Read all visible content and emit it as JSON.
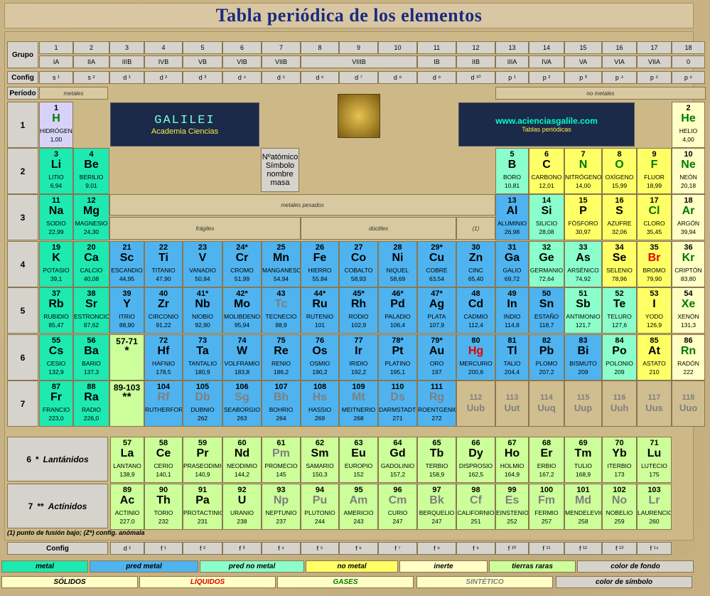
{
  "title": "Tabla periódica de los elementos",
  "labels": {
    "grupo": "Grupo",
    "config": "Config",
    "periodo": "Período",
    "metales": "metales",
    "no_metales": "no metales",
    "metales_pesados": "metales pesados",
    "fragiles": "frágiles",
    "ductiles": "dúctiles",
    "note1": "(1)",
    "lantanidos": "Lantánidos",
    "actinidos": "Actínidos",
    "lan_num": "6",
    "act_num": "7",
    "star1": "*",
    "star2": "**",
    "footnote": "(1) punto de fusión bajo; (Z*) config. anómala",
    "config_bottom": "Config"
  },
  "groups": [
    "1",
    "2",
    "3",
    "4",
    "5",
    "6",
    "7",
    "8",
    "9",
    "10",
    "11",
    "12",
    "13",
    "14",
    "15",
    "16",
    "17",
    "18"
  ],
  "subgroups": [
    "IA",
    "IIA",
    "IIIB",
    "IVB",
    "VB",
    "VIB",
    "VIIB",
    "VIIIB",
    "IB",
    "IIB",
    "IIIA",
    "IVA",
    "VA",
    "VIA",
    "VIIA",
    "0"
  ],
  "configs": [
    "s ¹",
    "s ²",
    "d ¹",
    "d ²",
    "d ³",
    "d ⁴",
    "d ⁵",
    "d ⁶",
    "d ⁷",
    "d ⁸",
    "d ⁹",
    "d ¹⁰",
    "p ¹",
    "p ²",
    "p ³",
    "p ⁴",
    "p ⁵",
    "p ⁶"
  ],
  "fconfigs": [
    "d ¹",
    "f ¹",
    "f ²",
    "f ³",
    "f ⁴",
    "f ⁵",
    "f ⁶",
    "f ⁷",
    "f ⁸",
    "f ⁹",
    "f ¹⁰",
    "f ¹¹",
    "f ¹²",
    "f ¹³",
    "f ¹⁴"
  ],
  "periods": [
    "1",
    "2",
    "3",
    "4",
    "5",
    "6",
    "7"
  ],
  "key": {
    "l1": "Nºatómico",
    "l2": "Símbolo",
    "l3": "nombre",
    "l4": "masa"
  },
  "galilei": {
    "title": "GALILEI",
    "sub": "Academia Ciencias"
  },
  "web": {
    "url": "www.acienciasgalile.com",
    "sub": "Tablas periódicas"
  },
  "placeholders": {
    "lan": "57-71",
    "lan_star": "*",
    "act": "89-103",
    "act_star": "**"
  },
  "elements": [
    [
      "1",
      "H",
      "HIDRÓGENO",
      "1,00"
    ],
    [
      "2",
      "He",
      "HELIO",
      "4,00"
    ],
    [
      "3",
      "Li",
      "LITIO",
      "6,94"
    ],
    [
      "4",
      "Be",
      "BERILIO",
      "9,01"
    ],
    [
      "5",
      "B",
      "BORO",
      "10,81"
    ],
    [
      "6",
      "C",
      "CARBONO",
      "12,01"
    ],
    [
      "7",
      "N",
      "NITRÓGENO",
      "14,00"
    ],
    [
      "8",
      "O",
      "OXÍGENO",
      "15,99"
    ],
    [
      "9",
      "F",
      "FLUOR",
      "18,99"
    ],
    [
      "10",
      "Ne",
      "NEÓN",
      "20,18"
    ],
    [
      "11",
      "Na",
      "SODIO",
      "22,99"
    ],
    [
      "12",
      "Mg",
      "MAGNESIO",
      "24,30"
    ],
    [
      "13",
      "Al",
      "ALUMINIO",
      "26,98"
    ],
    [
      "14",
      "Si",
      "SILICIO",
      "28,08"
    ],
    [
      "15",
      "P",
      "FÓSFORO",
      "30,97"
    ],
    [
      "16",
      "S",
      "AZUFRE",
      "32,06"
    ],
    [
      "17",
      "Cl",
      "CLORO",
      "35,45"
    ],
    [
      "18",
      "Ar",
      "ARGÓN",
      "39,94"
    ],
    [
      "19",
      "K",
      "POTASIO",
      "39,1"
    ],
    [
      "20",
      "Ca",
      "CALCIO",
      "40,08"
    ],
    [
      "21",
      "Sc",
      "ESCANDIO",
      "44,95"
    ],
    [
      "22",
      "Ti",
      "TITANIO",
      "47,90"
    ],
    [
      "23",
      "V",
      "VANADIO",
      "50,94"
    ],
    [
      "24*",
      "Cr",
      "CROMO",
      "51,99"
    ],
    [
      "25",
      "Mn",
      "MANGANESO",
      "54,94"
    ],
    [
      "26",
      "Fe",
      "HIERRO",
      "55,84"
    ],
    [
      "27",
      "Co",
      "COBALTO",
      "58,93"
    ],
    [
      "28",
      "Ni",
      "NIQUEL",
      "58,69"
    ],
    [
      "29*",
      "Cu",
      "COBRE",
      "63,54"
    ],
    [
      "30",
      "Zn",
      "CINC",
      "65,40"
    ],
    [
      "31",
      "Ga",
      "GALIO",
      "69,72"
    ],
    [
      "32",
      "Ge",
      "GERMANIO",
      "72,64"
    ],
    [
      "33",
      "As",
      "ARSÉNICO",
      "74,92"
    ],
    [
      "34",
      "Se",
      "SELENIO",
      "78,96"
    ],
    [
      "35",
      "Br",
      "BROMO",
      "79,90"
    ],
    [
      "36",
      "Kr",
      "CRIPTÓN",
      "83,80"
    ],
    [
      "37",
      "Rb",
      "RUBIDIO",
      "85,47"
    ],
    [
      "38",
      "Sr",
      "ESTRONCIO",
      "87,62"
    ],
    [
      "39",
      "Y",
      "ITRIO",
      "88,90"
    ],
    [
      "40",
      "Zr",
      "CIRCONIO",
      "91,22"
    ],
    [
      "41*",
      "Nb",
      "NIOBIO",
      "92,90"
    ],
    [
      "42*",
      "Mo",
      "MOLIBDENO",
      "95,94"
    ],
    [
      "43",
      "Tc",
      "TECNECIO",
      "98,9"
    ],
    [
      "44*",
      "Ru",
      "RUTENIO",
      "101"
    ],
    [
      "45*",
      "Rh",
      "RODIO",
      "102,9"
    ],
    [
      "46*",
      "Pd",
      "PALADIO",
      "106,4"
    ],
    [
      "47*",
      "Ag",
      "PLATA",
      "107,9"
    ],
    [
      "48",
      "Cd",
      "CADMIO",
      "112,4"
    ],
    [
      "49",
      "In",
      "INDIO",
      "114,8"
    ],
    [
      "50",
      "Sn",
      "ESTAÑO",
      "118,7"
    ],
    [
      "51",
      "Sb",
      "ANTIMONIO",
      "121,7"
    ],
    [
      "52",
      "Te",
      "TELURO",
      "127,6"
    ],
    [
      "53",
      "I",
      "YODO",
      "126,9"
    ],
    [
      "54",
      "Xe",
      "XENÓN",
      "131,3"
    ],
    [
      "55",
      "Cs",
      "CESIO",
      "132,9"
    ],
    [
      "56",
      "Ba",
      "BARIO",
      "137,3"
    ],
    [
      "72",
      "Hf",
      "HAFNIO",
      "178,5"
    ],
    [
      "73",
      "Ta",
      "TANTALIO",
      "180,9"
    ],
    [
      "74",
      "W",
      "VOLFRAMIO",
      "183,8"
    ],
    [
      "75",
      "Re",
      "RENIO",
      "186,2"
    ],
    [
      "76",
      "Os",
      "OSMIO",
      "190,2"
    ],
    [
      "77",
      "Ir",
      "IRIDIO",
      "192,2"
    ],
    [
      "78*",
      "Pt",
      "PLATINO",
      "195,1"
    ],
    [
      "79*",
      "Au",
      "ORO",
      "197"
    ],
    [
      "80",
      "Hg",
      "MERCURIO",
      "200,6"
    ],
    [
      "81",
      "Tl",
      "TALIO",
      "204,4"
    ],
    [
      "82",
      "Pb",
      "PLOMO",
      "207,2"
    ],
    [
      "83",
      "Bi",
      "BISMUTO",
      "209"
    ],
    [
      "84",
      "Po",
      "POLONIO",
      "209"
    ],
    [
      "85",
      "At",
      "ASTATO",
      "210"
    ],
    [
      "86",
      "Rn",
      "RADÓN",
      "222"
    ],
    [
      "87",
      "Fr",
      "FRANCIO",
      "223,0"
    ],
    [
      "88",
      "Ra",
      "RADIO",
      "226,0"
    ],
    [
      "104",
      "Rf",
      "RUTHERFOR-DIO-261",
      ""
    ],
    [
      "105",
      "Db",
      "DUBNIO",
      "262"
    ],
    [
      "106",
      "Sg",
      "SEABORGIO",
      "263"
    ],
    [
      "107",
      "Bh",
      "BOHRIO",
      "264"
    ],
    [
      "108",
      "Hs",
      "HASSIO",
      "269"
    ],
    [
      "109",
      "Mt",
      "MEITNERIO",
      "268"
    ],
    [
      "110",
      "Ds",
      "DARMSTADTIO",
      "271"
    ],
    [
      "111",
      "Rg",
      "ROENTGENIO",
      "272"
    ],
    [
      "112",
      "Uub",
      "",
      ""
    ],
    [
      "113",
      "Uut",
      "",
      ""
    ],
    [
      "114",
      "Uuq",
      "",
      ""
    ],
    [
      "115",
      "Uup",
      "",
      ""
    ],
    [
      "116",
      "Uuh",
      "",
      ""
    ],
    [
      "117",
      "Uus",
      "",
      ""
    ],
    [
      "118",
      "Uuo",
      "",
      ""
    ],
    [
      "57",
      "La",
      "LANTANO",
      "138,9"
    ],
    [
      "58",
      "Ce",
      "CERIO",
      "140,1"
    ],
    [
      "59",
      "Pr",
      "PRASEODIMIO",
      "140,9"
    ],
    [
      "60",
      "Nd",
      "NEODIMIO",
      "144,2"
    ],
    [
      "61",
      "Pm",
      "PROMECIO",
      "145"
    ],
    [
      "62",
      "Sm",
      "SAMARIO",
      "150,3"
    ],
    [
      "63",
      "Eu",
      "EUROPIO",
      "152"
    ],
    [
      "64",
      "Gd",
      "GADOLINIO",
      "157,2"
    ],
    [
      "65",
      "Tb",
      "TERBIO",
      "158,9"
    ],
    [
      "66",
      "Dy",
      "DISPROSIO",
      "162,5"
    ],
    [
      "67",
      "Ho",
      "HOLMIO",
      "164,9"
    ],
    [
      "68",
      "Er",
      "ERBIO",
      "167,2"
    ],
    [
      "69",
      "Tm",
      "TULIO",
      "168,9"
    ],
    [
      "70",
      "Yb",
      "ITERBIO",
      "173"
    ],
    [
      "71",
      "Lu",
      "LUTECIO",
      "175"
    ],
    [
      "89",
      "Ac",
      "ACTINIO",
      "227,0"
    ],
    [
      "90",
      "Th",
      "TORIO",
      "232"
    ],
    [
      "91",
      "Pa",
      "PROTACTINIO",
      "231"
    ],
    [
      "92",
      "U",
      "URANIO",
      "238"
    ],
    [
      "93",
      "Np",
      "NEPTUNIO",
      "237"
    ],
    [
      "94",
      "Pu",
      "PLUTONIO",
      "244"
    ],
    [
      "95",
      "Am",
      "AMERICIO",
      "243"
    ],
    [
      "96",
      "Cm",
      "CURIO",
      "247"
    ],
    [
      "97",
      "Bk",
      "BERQUELIO",
      "247"
    ],
    [
      "98",
      "Cf",
      "CALIFORNIO",
      "251"
    ],
    [
      "99",
      "Es",
      "EINSTENIO",
      "252"
    ],
    [
      "100",
      "Fm",
      "FERMIO",
      "257"
    ],
    [
      "101",
      "Md",
      "MENDELEVIO",
      "258"
    ],
    [
      "102",
      "No",
      "NOBELIO",
      "259"
    ],
    [
      "103",
      "Lr",
      "LAURENCIO",
      "260"
    ]
  ],
  "legend1": [
    "metal",
    "pred metal",
    "pred no metal",
    "no metal",
    "inerte",
    "tierras raras",
    "color de fondo"
  ],
  "legend2": [
    "SÓLIDOS",
    "LÍQUIDOS",
    "GASES",
    "SINTÉTICO",
    "color de símbolo"
  ],
  "colors": {
    "metal": "#1ee9b1",
    "pred_metal": "#4fb3ef",
    "pred_no_metal": "#8bffcb",
    "no_metal": "#ffff66",
    "inerte": "#ffffc6",
    "tierras_raras": "#ccff99",
    "fondo": "#cdb888",
    "liquido": "#e00000",
    "gas": "#007a00",
    "sintetico": "#7f7f7f",
    "title": "#1b2a80"
  }
}
